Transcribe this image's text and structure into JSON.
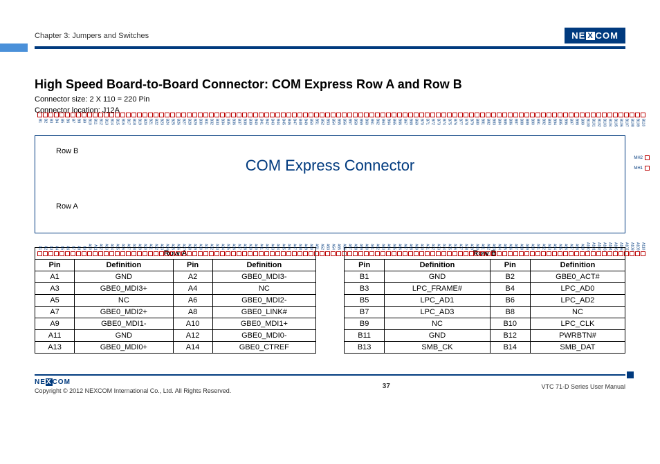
{
  "header": {
    "chapter": "Chapter 3: Jumpers and Switches",
    "brand": "NEXCOM"
  },
  "title": "High Speed Board-to-Board Connector: COM Express Row A and Row B",
  "subtitle1": "Connector size: 2 X 110 = 220 Pin",
  "subtitle2": "Connector location: J12A",
  "diagram": {
    "title": "COM Express Connector",
    "rowB": "Row B",
    "rowA": "Row A",
    "mh1": "MH1",
    "mh2": "MH2"
  },
  "tableA": {
    "title": "Row A",
    "headers": [
      "Pin",
      "Definition",
      "Pin",
      "Definition"
    ],
    "rows": [
      [
        "A1",
        "GND",
        "A2",
        "GBE0_MDI3-"
      ],
      [
        "A3",
        "GBE0_MDI3+",
        "A4",
        "NC"
      ],
      [
        "A5",
        "NC",
        "A6",
        "GBE0_MDI2-"
      ],
      [
        "A7",
        "GBE0_MDI2+",
        "A8",
        "GBE0_LINK#"
      ],
      [
        "A9",
        "GBE0_MDI1-",
        "A10",
        "GBE0_MDI1+"
      ],
      [
        "A11",
        "GND",
        "A12",
        "GBE0_MDI0-"
      ],
      [
        "A13",
        "GBE0_MDI0+",
        "A14",
        "GBE0_CTREF"
      ]
    ]
  },
  "tableB": {
    "title": "Row B",
    "headers": [
      "Pin",
      "Definition",
      "Pin",
      "Definition"
    ],
    "rows": [
      [
        "B1",
        "GND",
        "B2",
        "GBE0_ACT#"
      ],
      [
        "B3",
        "LPC_FRAME#",
        "B4",
        "LPC_AD0"
      ],
      [
        "B5",
        "LPC_AD1",
        "B6",
        "LPC_AD2"
      ],
      [
        "B7",
        "LPC_AD3",
        "B8",
        "NC"
      ],
      [
        "B9",
        "NC",
        "B10",
        "LPC_CLK"
      ],
      [
        "B11",
        "GND",
        "B12",
        "PWRBTN#"
      ],
      [
        "B13",
        "SMB_CK",
        "B14",
        "SMB_DAT"
      ]
    ]
  },
  "footer": {
    "brand": "NEXCOM",
    "copyright": "Copyright © 2012 NEXCOM International Co., Ltd. All Rights Reserved.",
    "page": "37",
    "docname": "VTC 71-D Series User Manual"
  }
}
